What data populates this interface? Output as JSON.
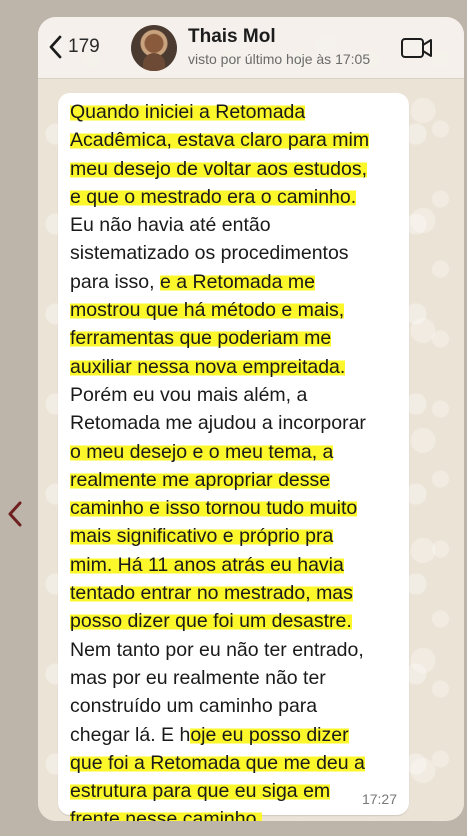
{
  "outer": {
    "prev_icon": "chevron-left-icon"
  },
  "header": {
    "back_icon": "chevron-left-icon",
    "back_count": "179",
    "contact_name": "Thais Mol",
    "contact_status": "visto por último hoje às 17:05",
    "video_icon": "video-camera-icon"
  },
  "message": {
    "time": "17:27",
    "highlight_color": "#fbf72a",
    "lines": [
      {
        "pre": "",
        "hl": "Quando iniciei a Retomada",
        "post": ""
      },
      {
        "pre": "",
        "hl": "Acadêmica, estava claro para mim",
        "post": ""
      },
      {
        "pre": "",
        "hl": "meu desejo de voltar aos estudos,",
        "post": ""
      },
      {
        "pre": "",
        "hl": "e que o mestrado era o caminho.",
        "post": ""
      },
      {
        "pre": "Eu não havia até então",
        "hl": "",
        "post": ""
      },
      {
        "pre": "sistematizado os procedimentos",
        "hl": "",
        "post": ""
      },
      {
        "pre": "para isso, ",
        "hl": "e a Retomada me",
        "post": ""
      },
      {
        "pre": "",
        "hl": "mostrou que há método e mais,",
        "post": ""
      },
      {
        "pre": "",
        "hl": "ferramentas que poderiam me",
        "post": ""
      },
      {
        "pre": "",
        "hl": "auxiliar nessa nova empreitada.",
        "post": ""
      },
      {
        "pre": "Porém eu vou mais além, a",
        "hl": "",
        "post": ""
      },
      {
        "pre": "Retomada me ajudou a incorporar",
        "hl": "",
        "post": ""
      },
      {
        "pre": "",
        "hl": "o meu desejo e o meu tema, a",
        "post": ""
      },
      {
        "pre": "",
        "hl": "realmente me apropriar desse",
        "post": ""
      },
      {
        "pre": "",
        "hl": "caminho e isso tornou tudo muito",
        "post": ""
      },
      {
        "pre": "",
        "hl": "mais significativo e próprio pra",
        "post": ""
      },
      {
        "pre": "",
        "hl": "mim. Há 11 anos atrás eu havia",
        "post": ""
      },
      {
        "pre": "",
        "hl": "tentado entrar no mestrado, mas",
        "post": ""
      },
      {
        "pre": "",
        "hl": "posso dizer que foi um desastre.",
        "post": ""
      },
      {
        "pre": "Nem tanto por eu não ter entrado,",
        "hl": "",
        "post": ""
      },
      {
        "pre": "mas por eu realmente não ter",
        "hl": "",
        "post": ""
      },
      {
        "pre": "construído um caminho para",
        "hl": "",
        "post": ""
      },
      {
        "pre": "chegar lá. E h",
        "hl": "oje eu posso dizer",
        "post": ""
      },
      {
        "pre": "",
        "hl": "que foi a Retomada que me deu a",
        "post": ""
      },
      {
        "pre": "",
        "hl": "estrutura para que eu siga em",
        "post": ""
      },
      {
        "pre": "",
        "hl": "frente nesse caminho.",
        "post": ""
      }
    ]
  }
}
